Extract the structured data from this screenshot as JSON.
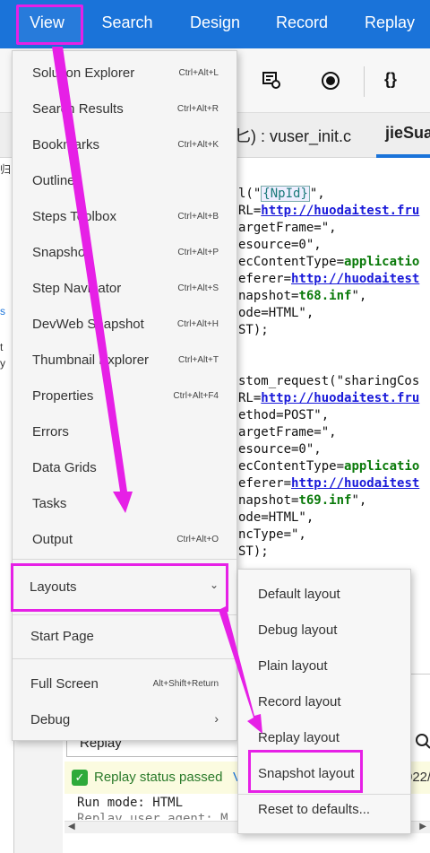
{
  "menubar": {
    "items": [
      "View",
      "Search",
      "Design",
      "Record",
      "Replay"
    ]
  },
  "toolbar": {
    "icons": [
      "snapshot-toolbar-icon",
      "record-icon",
      "braces-icon"
    ],
    "braces_glyph": "{}"
  },
  "tabs": [
    {
      "label": "匕) : vuser_init.c"
    },
    {
      "label": "jieSua"
    }
  ],
  "left_pane": {
    "fragments": [
      "]",
      "归",
      "s",
      "t",
      "y"
    ]
  },
  "code": {
    "lines": [
      {
        "parts": [
          {
            "t": "l(\"",
            "c": "plain"
          },
          {
            "t": "{NpId}",
            "c": "tag"
          },
          {
            "t": "\",",
            "c": "plain"
          }
        ]
      },
      {
        "parts": [
          {
            "t": "RL=",
            "c": "plain"
          },
          {
            "t": "http://huodaitest.fru",
            "c": "url"
          }
        ]
      },
      {
        "parts": [
          {
            "t": "argetFrame=\",",
            "c": "plain"
          }
        ]
      },
      {
        "parts": [
          {
            "t": "esource=0\",",
            "c": "plain"
          }
        ]
      },
      {
        "parts": [
          {
            "t": "ecContentType=",
            "c": "plain"
          },
          {
            "t": "applicatio",
            "c": "str"
          }
        ]
      },
      {
        "parts": [
          {
            "t": "eferer=",
            "c": "plain"
          },
          {
            "t": "http://huodaitest",
            "c": "url"
          }
        ]
      },
      {
        "parts": [
          {
            "t": "napshot=",
            "c": "plain"
          },
          {
            "t": "t68.inf",
            "c": "str"
          },
          {
            "t": "\",",
            "c": "plain"
          }
        ]
      },
      {
        "parts": [
          {
            "t": "ode=HTML\",",
            "c": "plain"
          }
        ]
      },
      {
        "parts": [
          {
            "t": "ST);",
            "c": "plain"
          }
        ]
      },
      {
        "parts": [
          {
            "t": "",
            "c": "plain"
          }
        ]
      },
      {
        "parts": [
          {
            "t": "",
            "c": "plain"
          }
        ]
      },
      {
        "parts": [
          {
            "t": "stom_request(\"sharingCos",
            "c": "plain"
          }
        ]
      },
      {
        "parts": [
          {
            "t": "RL=",
            "c": "plain"
          },
          {
            "t": "http://huodaitest.fru",
            "c": "url"
          }
        ]
      },
      {
        "parts": [
          {
            "t": "ethod=POST\",",
            "c": "plain"
          }
        ]
      },
      {
        "parts": [
          {
            "t": "argetFrame=\",",
            "c": "plain"
          }
        ]
      },
      {
        "parts": [
          {
            "t": "esource=0\",",
            "c": "plain"
          }
        ]
      },
      {
        "parts": [
          {
            "t": "ecContentType=",
            "c": "plain"
          },
          {
            "t": "applicatio",
            "c": "str"
          }
        ]
      },
      {
        "parts": [
          {
            "t": "eferer=",
            "c": "plain"
          },
          {
            "t": "http://huodaitest",
            "c": "url"
          }
        ]
      },
      {
        "parts": [
          {
            "t": "napshot=",
            "c": "plain"
          },
          {
            "t": "t69.inf",
            "c": "str"
          },
          {
            "t": "\",",
            "c": "plain"
          }
        ]
      },
      {
        "parts": [
          {
            "t": "ode=HTML\",",
            "c": "plain"
          }
        ]
      },
      {
        "parts": [
          {
            "t": "ncType=\",",
            "c": "plain"
          }
        ]
      },
      {
        "parts": [
          {
            "t": "ST);",
            "c": "plain"
          }
        ]
      },
      {
        "parts": [
          {
            "t": "",
            "c": "plain"
          }
        ]
      },
      {
        "parts": [
          {
            "t": "",
            "c": "plain"
          }
        ]
      },
      {
        "parts": [
          {
            "t": "                   s\",",
            "c": "plain"
          }
        ]
      }
    ]
  },
  "view_menu": {
    "items": [
      {
        "label": "Solution Explorer",
        "shortcut": "Ctrl+Alt+L"
      },
      {
        "label": "Search Results",
        "shortcut": "Ctrl+Alt+R"
      },
      {
        "label": "Bookmarks",
        "shortcut": "Ctrl+Alt+K"
      },
      {
        "label": "Outline",
        "shortcut": ""
      },
      {
        "label": "Steps Toolbox",
        "shortcut": "Ctrl+Alt+B"
      },
      {
        "label": "Snapshot",
        "shortcut": "Ctrl+Alt+P"
      },
      {
        "label": "Step Navigator",
        "shortcut": "Ctrl+Alt+S"
      },
      {
        "label": "DevWeb Snapshot",
        "shortcut": "Ctrl+Alt+H"
      },
      {
        "label": "Thumbnail Explorer",
        "shortcut": "Ctrl+Alt+T"
      },
      {
        "label": "Properties",
        "shortcut": "Ctrl+Alt+F4"
      },
      {
        "label": "Errors",
        "shortcut": ""
      },
      {
        "label": "Data Grids",
        "shortcut": ""
      },
      {
        "label": "Tasks",
        "shortcut": ""
      },
      {
        "label": "Output",
        "shortcut": "Ctrl+Alt+O"
      }
    ],
    "layouts_label": "Layouts",
    "start_page": "Start Page",
    "full_screen": {
      "label": "Full Screen",
      "shortcut": "Alt+Shift+Return"
    },
    "debug": "Debug"
  },
  "layouts_submenu": {
    "items": [
      "Default layout",
      "Debug layout",
      "Plain layout",
      "Record layout",
      "Replay layout",
      "Snapshot layout"
    ],
    "reset": "Reset to defaults..."
  },
  "bottom": {
    "replay_select": "Replay",
    "status_text": "Replay status passed",
    "status_extra": "V",
    "date_fragment": "022/",
    "run_mode": "Run mode: HTML",
    "run_line2": "Replay user agent: M"
  },
  "colors": {
    "accent": "#1a73d9",
    "highlight": "#e620e6",
    "status_bg": "#fbfbe0",
    "status_text": "#2a7a2a"
  }
}
